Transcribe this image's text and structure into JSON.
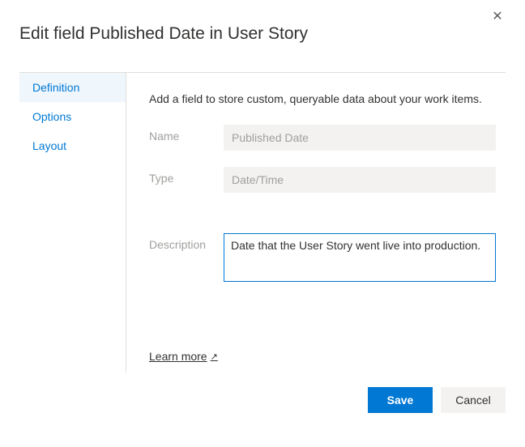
{
  "dialog": {
    "title": "Edit field Published Date in User Story",
    "close_label": "✕"
  },
  "tabs": [
    {
      "id": "definition",
      "label": "Definition",
      "selected": true
    },
    {
      "id": "options",
      "label": "Options",
      "selected": false
    },
    {
      "id": "layout",
      "label": "Layout",
      "selected": false
    }
  ],
  "pane": {
    "description": "Add a field to store custom, queryable data about your work items.",
    "name_label": "Name",
    "name_value": "Published Date",
    "type_label": "Type",
    "type_value": "Date/Time",
    "desc_label": "Description",
    "desc_value": "Date that the User Story went live into production.",
    "learn_more": "Learn more",
    "learn_more_icon": "↗"
  },
  "footer": {
    "save": "Save",
    "cancel": "Cancel"
  }
}
